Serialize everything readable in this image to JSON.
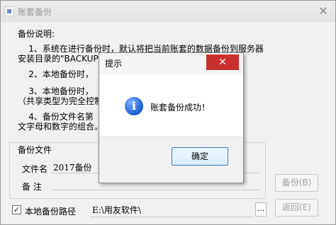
{
  "window": {
    "title": "账套备份",
    "close_glyph": "✕"
  },
  "intro": {
    "heading": "备份说明:",
    "p1": "    1、系统在进行备份时，默认将把当前账套的数据备份到服务器\n安装目录的\"BACKUP\"目",
    "p2": "    2、本地备份时，",
    "p3": "    3、本地备份时，                              享出来\n（共享类型为完全控制",
    "p4": "    4、备份文件名第                                名使用英\n文字母和数字的组合。"
  },
  "group": {
    "legend": "备份文件",
    "filename_label": "文件名",
    "filename_value": "2017备份",
    "note_label": "备  注",
    "note_value": ""
  },
  "buttons": {
    "backup": "备份(B)",
    "back": "返回(E)"
  },
  "local_path": {
    "checked": true,
    "check_glyph": "✓",
    "label": "本地备份路径",
    "value": "E:\\用友软件\\",
    "browse": "..."
  },
  "dialog": {
    "title": "提示",
    "close_glyph": "✕",
    "icon_glyph": "i",
    "message": "账套备份成功！",
    "ok": "确定"
  }
}
